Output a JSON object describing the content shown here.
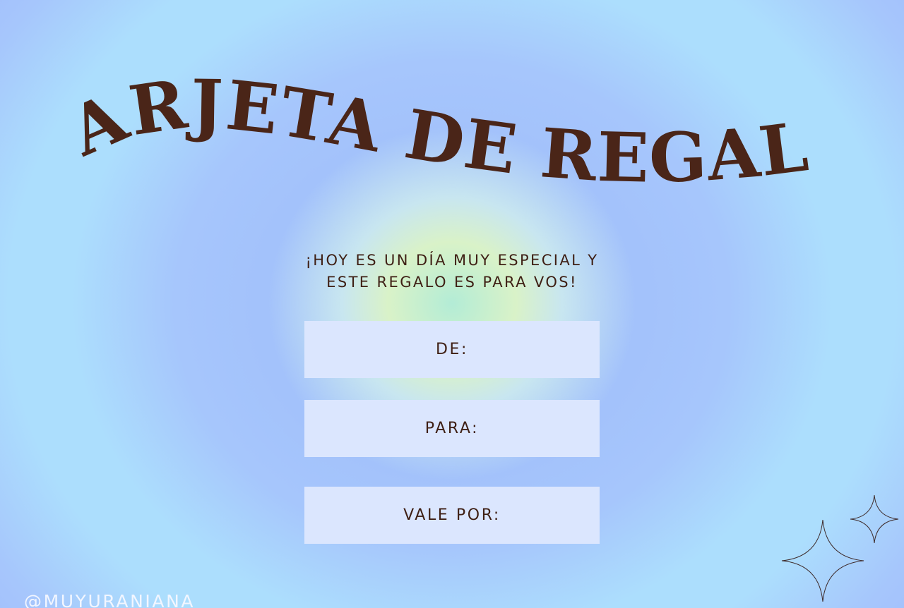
{
  "card": {
    "title": "TARJETA DE REGALO",
    "subtitle_line1": "¡HOY ES UN DÍA MUY ESPECIAL Y",
    "subtitle_line2": "ESTE REGALO ES PARA VOS!",
    "fields": {
      "from_label": "DE:",
      "to_label": "PARA:",
      "value_label": "VALE POR:"
    },
    "handle": "@MUYURANIANA"
  },
  "colors": {
    "title": "#4a2518",
    "text": "#3e1f14",
    "field_bg": "#dbe6fe",
    "handle": "#f2f6ff",
    "background_blue": "#a3c2fb",
    "background_light": "#acdefd",
    "center_glow": "#d9f2c8"
  },
  "icons": {
    "sparkle_large": "sparkle-icon",
    "sparkle_small": "sparkle-icon"
  }
}
